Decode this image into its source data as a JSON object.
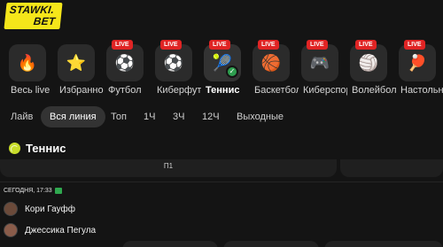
{
  "brand": {
    "line1": "STAWKI.",
    "line2": "BET"
  },
  "sports": [
    {
      "label": "Весь live",
      "icon": "fire-icon",
      "glyph": "🔥",
      "live": false,
      "active": false
    },
    {
      "label": "Избранное",
      "icon": "star-icon",
      "glyph": "⭐",
      "live": false,
      "active": false
    },
    {
      "label": "Футбол",
      "icon": "football-icon",
      "glyph": "⚽",
      "live": true,
      "active": false
    },
    {
      "label": "Киберфутбол",
      "icon": "cyber-football-icon",
      "glyph": "⚽",
      "live": true,
      "active": false
    },
    {
      "label": "Теннис",
      "icon": "tennis-ball-icon",
      "glyph": "🎾",
      "live": true,
      "active": true
    },
    {
      "label": "Баскетбол",
      "icon": "basketball-icon",
      "glyph": "🏀",
      "live": true,
      "active": false
    },
    {
      "label": "Киберспорт",
      "icon": "gamepad-icon",
      "glyph": "🎮",
      "live": true,
      "active": false
    },
    {
      "label": "Волейбол",
      "icon": "volleyball-icon",
      "glyph": "🏐",
      "live": true,
      "active": false
    },
    {
      "label": "Настольный теннис",
      "icon": "table-tennis-icon",
      "glyph": "🏓",
      "live": true,
      "active": false
    }
  ],
  "live_badge": "LIVE",
  "filters": [
    "Лайв",
    "Вся линия",
    "Топ",
    "1Ч",
    "3Ч",
    "12Ч",
    "Выходные"
  ],
  "active_filter": "Вся линия",
  "section_title": "Теннис",
  "market_label": "П1",
  "event": {
    "time": "СЕГОДНЯ, 17:33",
    "players": [
      "Кори Гауфф",
      "Джессика Пегула"
    ]
  },
  "colors": {
    "brand_yellow": "#f5e61a",
    "live_red": "#e02424",
    "bg": "#141414"
  }
}
